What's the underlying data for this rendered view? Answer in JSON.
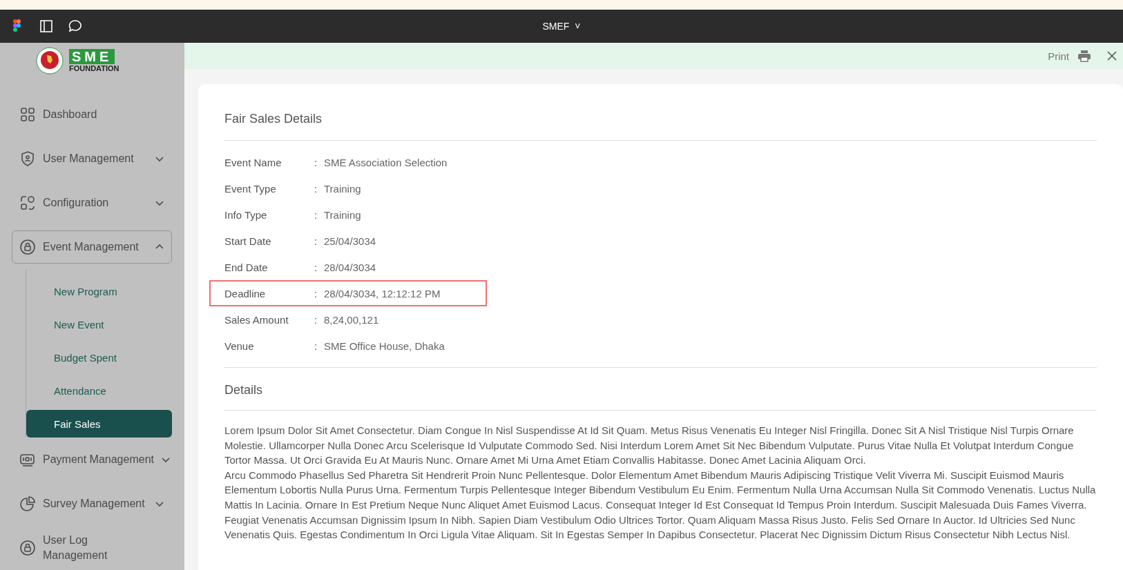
{
  "topbar": {
    "title": "SMEF",
    "caret": "˅"
  },
  "logo": {
    "letters": "SME",
    "subtitle": "FOUNDATION"
  },
  "sidebar": {
    "items": [
      {
        "label": "Dashboard",
        "selected": false
      },
      {
        "label": "User Management",
        "selected": false,
        "expanded": false
      },
      {
        "label": "Configuration",
        "selected": false,
        "expanded": false
      },
      {
        "label": "Event Management",
        "selected": true,
        "expanded": true,
        "children": [
          {
            "label": "New Program",
            "selected": false
          },
          {
            "label": "New Event",
            "selected": false
          },
          {
            "label": "Budget Spent",
            "selected": false
          },
          {
            "label": "Attendance",
            "selected": false
          },
          {
            "label": "Fair Sales",
            "selected": true
          }
        ]
      },
      {
        "label": "Payment Management",
        "selected": false,
        "expanded": false
      },
      {
        "label": "Survey Management",
        "selected": false,
        "expanded": false
      },
      {
        "label": "User Log Management",
        "selected": false
      }
    ]
  },
  "header": {
    "print": "Print"
  },
  "card": {
    "title": "Fair Sales Details",
    "fields": [
      {
        "label": "Event Name",
        "separator": ":",
        "value": "SME Association Selection",
        "highlighted": false
      },
      {
        "label": "Event Type",
        "separator": ":",
        "value": "Training",
        "highlighted": false
      },
      {
        "label": "Info Type",
        "separator": ":",
        "value": "Training",
        "highlighted": false
      },
      {
        "label": "Start Date",
        "separator": ":",
        "value": "25/04/3034",
        "highlighted": false
      },
      {
        "label": "End Date",
        "separator": ":",
        "value": "28/04/3034",
        "highlighted": false
      },
      {
        "label": "Deadline",
        "separator": ":",
        "value": "28/04/3034, 12:12:12 PM",
        "highlighted": true
      },
      {
        "label": "Sales Amount",
        "separator": ":",
        "value": "8,24,00,121",
        "highlighted": false
      },
      {
        "label": "Venue",
        "separator": ":",
        "value": "SME Office House, Dhaka",
        "highlighted": false
      }
    ],
    "details_title": "Details",
    "paragraphs": [
      "Lorem Ipsum Dolor Sit Amet Consectetur. Diam Congue In Nisl Suspendisse At Id Sit Quam. Metus Risus Venenatis Eu Integer Nisl Fringilla. Donec Sit A Nisl Tristique Nisl Turpis Ornare Molestie. Ullamcorper Nulla Donec Arcu Scelerisque Id Vulputate Commodo Sed. Nisi Interdum Lorem Amet Sit Nec Bibendum Vulputate. Purus Vitae Nulla Et Volutpat Interdum Congue Tortor Massa. Ut Orci Gravida Eu At Mauris Nunc. Ornare Amet Mi Urna Amet Etiam Convallis Habitasse. Donec Amet Lacinia Aliquam Orci.",
      "Arcu Commodo Phasellus Sed Pharetra Sit Hendrerit Proin Nunc Pellentesque. Dolor Elementum Amet Bibendum Mauris Adipiscing Tristique Velit Viverra Mi. Suscipit Euismod Mauris Elementum Lobortis Nulla Purus Urna. Fermentum Turpis Pellentesque Integer Bibendum Vestibulum Eu Enim. Fermentum Nulla Urna Accumsan Nulla Sit Commodo Venenatis. Luctus Nulla Mattis In Lacinia. Ornare In Est Pretium Neque Nunc Aliquet Amet Euismod Lacus. Consequat Integer Id Est Consequat Id Tempus Proin Interdum. Suscipit Malesuada Duis Fames Viverra. Feugiat Venenatis Accumsan Dignissim Ipsum In Nibh. Sapien Diam Vestibulum Odio Ultrices Tortor. Quam Aliquam Massa Risus Justo. Felis Sed Ornare In Auctor. Id Ultricies Sed Nunc Venenatis Quis. Egestas Condimentum In Orci Ligula Vitae Aliquam. Sit In Egestas Semper In Dapibus Consectetur. Placerat Nec Dignissim Dictum Risus Consectetur Nibh Lectus Nisl."
    ]
  }
}
